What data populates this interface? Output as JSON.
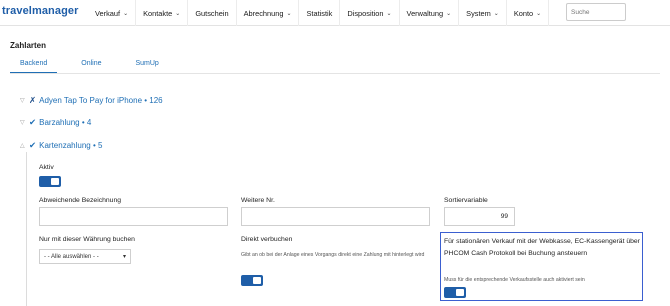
{
  "app": {
    "logo": "travelmanager"
  },
  "nav": [
    {
      "label": "Verkauf",
      "has_menu": true
    },
    {
      "label": "Kontakte",
      "has_menu": true
    },
    {
      "label": "Gutschein",
      "has_menu": false
    },
    {
      "label": "Abrechnung",
      "has_menu": true
    },
    {
      "label": "Statistik",
      "has_menu": false
    },
    {
      "label": "Disposition",
      "has_menu": true
    },
    {
      "label": "Verwaltung",
      "has_menu": true
    },
    {
      "label": "System",
      "has_menu": true
    },
    {
      "label": "Konto",
      "has_menu": true
    }
  ],
  "search": {
    "placeholder": "Suche"
  },
  "page": {
    "title": "Zahlarten"
  },
  "tabs": [
    {
      "label": "Backend",
      "active": true
    },
    {
      "label": "Online",
      "active": false
    },
    {
      "label": "SumUp",
      "active": false
    }
  ],
  "sections": [
    {
      "label": "Adyen Tap To Pay for iPhone • 126",
      "status": "disabled"
    },
    {
      "label": "Barzahlung • 4",
      "status": "enabled"
    },
    {
      "label": "Kartenzahlung • 5",
      "status": "enabled",
      "expanded": true
    }
  ],
  "form": {
    "aktiv_label": "Aktiv",
    "abweichende_label": "Abweichende Bezeichnung",
    "abweichende_value": "",
    "weitere_label": "Weitere Nr.",
    "weitere_value": "",
    "sortier_label": "Sortiervariable",
    "sortier_value": "99",
    "waehrung_label": "Nur mit dieser Währung buchen",
    "waehrung_selected": "- - Alle auswählen - -",
    "direkt_label": "Direkt verbuchen",
    "direkt_hint": "Gibt an ob bei der Anlage eines Vorgangs direkt eine Zahlung mit hinterlegt wird",
    "stationaer_label": "Für stationären Verkauf mit der Webkasse, EC-Kassengerät über PHCOM Cash Protokoll bei Buchung ansteuern",
    "stationaer_hint": "Muss für die entsprechende Verkaufsstelle auch aktiviert sein"
  },
  "icons": {
    "enabled_mark": "check-icon",
    "disabled_mark": "cross-icon"
  },
  "colors": {
    "accent": "#1f6fb5",
    "toggle": "#1f5ea8",
    "highlight_border": "#3b5fd0"
  }
}
